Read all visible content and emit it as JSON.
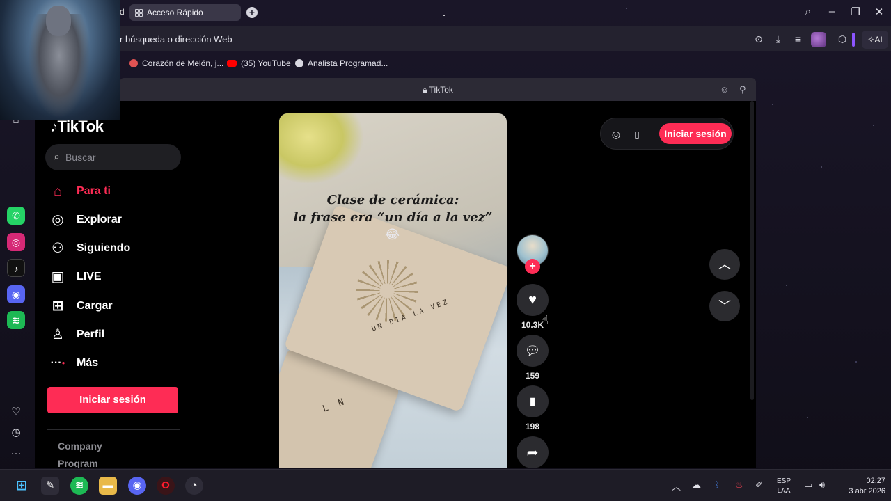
{
  "browser": {
    "tab_cut_text": "d",
    "active_tab_label": "Acceso Rápido",
    "address_placeholder": "r búsqueda o dirección Web",
    "ai_label": "AI",
    "bookmarks": [
      {
        "label": "Corazón de Melón, j...",
        "icon": "cake-icon",
        "color": "#e05353"
      },
      {
        "label": "(35) YouTube",
        "icon": "youtube-icon",
        "color": "#ff0000"
      },
      {
        "label": "Analista Programad...",
        "icon": "instituto-icon",
        "color": "#d8d8e0"
      }
    ]
  },
  "opera_sidebar": {
    "apps": [
      {
        "name": "whatsapp-icon",
        "color": "#25d366",
        "glyph": "✆"
      },
      {
        "name": "instagram-icon",
        "color": "#d62976",
        "glyph": "◎"
      },
      {
        "name": "tiktok-app-icon",
        "color": "#111111",
        "glyph": "♪"
      },
      {
        "name": "discord-icon",
        "color": "#5865f2",
        "glyph": "◉"
      },
      {
        "name": "spotify-icon",
        "color": "#1db954",
        "glyph": "≋"
      }
    ]
  },
  "popup": {
    "title": "TikTok"
  },
  "tiktok": {
    "logo": "TikTok",
    "search_placeholder": "Buscar",
    "nav": [
      {
        "label": "Para ti",
        "icon": "home-icon",
        "glyph": "⌂",
        "active": true
      },
      {
        "label": "Explorar",
        "icon": "compass-icon",
        "glyph": "◎",
        "active": false
      },
      {
        "label": "Siguiendo",
        "icon": "following-icon",
        "glyph": "⚇",
        "active": false
      },
      {
        "label": "LIVE",
        "icon": "live-tv-icon",
        "glyph": "▣",
        "active": false
      },
      {
        "label": "Cargar",
        "icon": "upload-plus-icon",
        "glyph": "⊞",
        "active": false
      },
      {
        "label": "Perfil",
        "icon": "profile-icon",
        "glyph": "♙",
        "active": false
      },
      {
        "label": "Más",
        "icon": "more-dots-icon",
        "glyph": "···",
        "active": false
      }
    ],
    "login_label": "Iniciar sesión",
    "footer": [
      "Company",
      "Program"
    ],
    "video": {
      "caption_line1": "Clase de cerámica:",
      "caption_line2": "la frase era “un  día a la vez”",
      "emoji": "😂",
      "stamp_text": "UN DIA LA VEZ",
      "stamp_text2": "L N"
    },
    "actions": {
      "likes": "10.3K",
      "comments": "159",
      "saves": "198"
    },
    "top_login_label": "Iniciar sesión"
  },
  "taskbar": {
    "language_top": "ESP",
    "language_bottom": "LAA",
    "time": "02:27",
    "date": "3 abr 2026"
  }
}
